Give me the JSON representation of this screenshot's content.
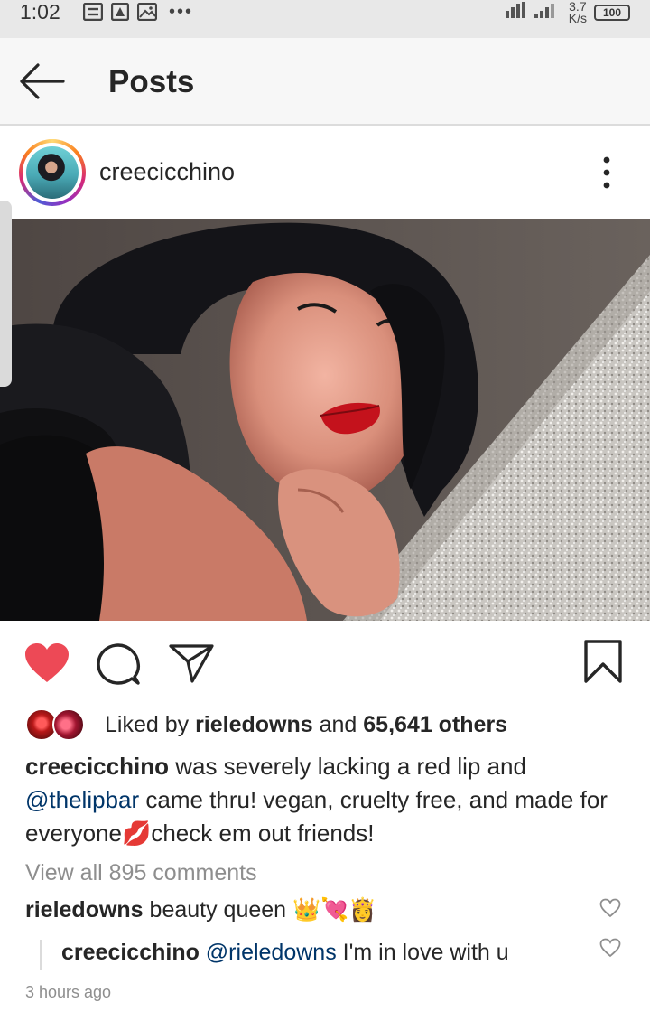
{
  "status_bar": {
    "time": "1:02",
    "dots": "•••",
    "net_speed_value": "3.7",
    "net_speed_unit": "K/s",
    "battery": "100"
  },
  "app_bar": {
    "title": "Posts"
  },
  "post": {
    "username": "creecicchino",
    "likes": {
      "prefix": "Liked by ",
      "user": "rieledowns",
      "connector": " and ",
      "others": "65,641 others"
    },
    "caption": {
      "username": "creecicchino",
      "text_1": " was severely lacking a red lip and ",
      "mention": "@thelipbar",
      "text_2": " came thru! vegan, cruelty free, and made for everyone",
      "emoji": "💋",
      "text_3": "check em out friends!"
    },
    "view_comments": "View all 895 comments",
    "comments": [
      {
        "username": "rieledowns",
        "text": " beauty queen ",
        "emoji": "👑💘👸"
      },
      {
        "username": "creecicchino",
        "mention": " @rieledowns",
        "text": " I'm in love with u"
      }
    ],
    "timestamp": "3 hours ago",
    "liked": true
  },
  "colors": {
    "like_red": "#ed4956",
    "mention_blue": "#003569",
    "muted_gray": "#8e8e8e"
  }
}
